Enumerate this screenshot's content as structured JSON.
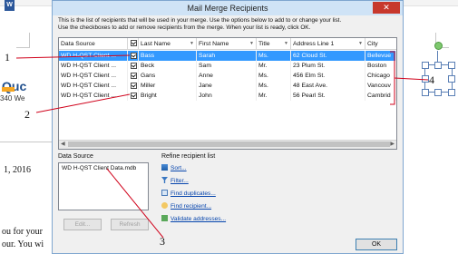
{
  "document": {
    "app_icon": "W",
    "logo_text": "Quc",
    "address_fragment": "340 We",
    "date_fragment": "1, 2016",
    "body_line1": "ou for your",
    "body_line2": "our. You wi"
  },
  "dialog": {
    "title": "Mail Merge Recipients",
    "close_label": "✕",
    "intro_line1": "This is the list of recipients that will be used in your merge.  Use the options below to add to or change your list.",
    "intro_line2": "Use the checkboxes to add or remove recipients from the merge.  When your list is ready, click OK.",
    "columns": [
      "Data Source",
      "",
      "Last Name",
      "First Name",
      "Title",
      "Address Line 1",
      "City"
    ],
    "rows": [
      {
        "source": "WD H-QST Client ...",
        "last": "Bass",
        "first": "Sarah",
        "title": "Ms.",
        "address": "62 Cloud St.",
        "city": "Bellevue",
        "selected": true
      },
      {
        "source": "WD H-QST Client ...",
        "last": "Beck",
        "first": "Sam",
        "title": "Mr.",
        "address": "23 Plum St.",
        "city": "Boston",
        "selected": false
      },
      {
        "source": "WD H-QST Client ...",
        "last": "Gans",
        "first": "Anne",
        "title": "Ms.",
        "address": "456 Elm St.",
        "city": "Chicago",
        "selected": false
      },
      {
        "source": "WD H-QST Client ...",
        "last": "Miller",
        "first": "Jane",
        "title": "Ms.",
        "address": "48 East Ave.",
        "city": "Vancouv",
        "selected": false
      },
      {
        "source": "WD H-QST Client ...",
        "last": "Bright",
        "first": "John",
        "title": "Mr.",
        "address": "56 Pearl St.",
        "city": "Cambrid",
        "selected": false
      }
    ],
    "data_source_label": "Data Source",
    "data_source_item": "WD H-QST Client Data.mdb",
    "edit_label": "Edit...",
    "refresh_label": "Refresh",
    "refine_label": "Refine recipient list",
    "refine_links": [
      "Sort...",
      "Filter...",
      "Find duplicates...",
      "Find recipient...",
      "Validate addresses..."
    ],
    "ok_label": "OK"
  },
  "callouts": [
    "1",
    "2",
    "3",
    "4"
  ],
  "colors": {
    "selection": "#3399ff",
    "callout_line": "#d0021b",
    "titlebar": "#cfe3f6",
    "link": "#0645ad"
  }
}
